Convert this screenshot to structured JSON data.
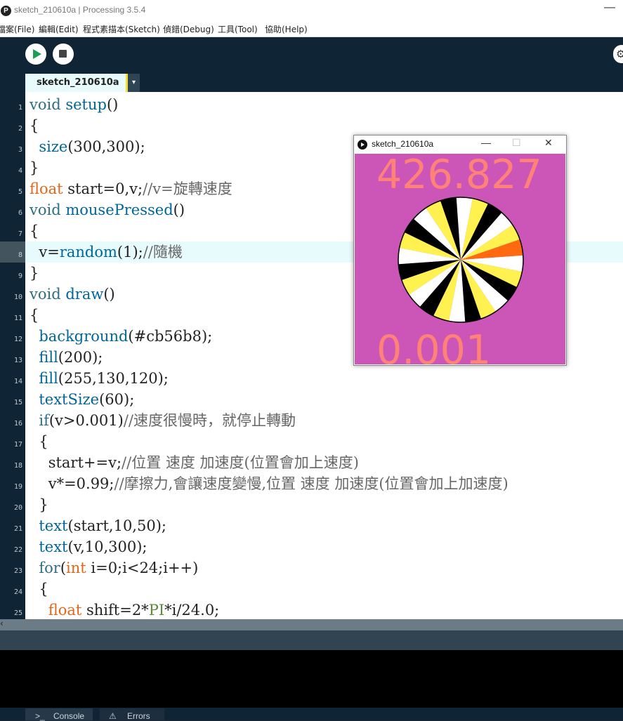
{
  "window": {
    "title": "sketch_210610a | Processing 3.5.4",
    "minimize": "—"
  },
  "menu": [
    "檔案(File)",
    "編輯(Edit)",
    "程式素描本(Sketch)",
    "偵錯(Debug)",
    "工具(Tool)",
    "協助(Help)"
  ],
  "tab": {
    "label": "sketch_210610a",
    "menu_glyph": "▾"
  },
  "code_lines": [
    "1",
    "2",
    "3",
    "4",
    "5",
    "6",
    "7",
    "8",
    "9",
    "10",
    "11",
    "12",
    "13",
    "14",
    "15",
    "16",
    "17",
    "18",
    "19",
    "20",
    "21",
    "22",
    "23",
    "24",
    "25"
  ],
  "code": {
    "l1a": "void",
    "l1b": " setup",
    "l1c": "()",
    "l2": "{",
    "l3a": "  size",
    "l3b": "(300,300);",
    "l4": "}",
    "l5a": "float",
    "l5b": " start=0,v;",
    "l5c": "//v=旋轉速度",
    "l6a": "void",
    "l6b": " mousePressed",
    "l6c": "()",
    "l7": "{",
    "l8a": "  v=",
    "l8b": "random",
    "l8c": "(1);",
    "l8d": "//隨機",
    "l9": "}",
    "l10a": "void",
    "l10b": " draw",
    "l10c": "()",
    "l11": "{",
    "l12a": "  background",
    "l12b": "(#cb56b8);",
    "l13a": "  fill",
    "l13b": "(200);",
    "l14a": "  fill",
    "l14b": "(255,130,120);",
    "l15a": "  textSize",
    "l15b": "(60);",
    "l16a": "  if",
    "l16b": "(v>0.001)",
    "l16c": "//速度很慢時，就停止轉動",
    "l17": "  {",
    "l18a": "    start+=v;",
    "l18b": "//位置 速度 加速度(位置會加上速度)",
    "l19a": "    v*=0.99;",
    "l19b": "//摩擦力,會讓速度變慢,位置 速度 加速度(位置會加上加速度)",
    "l20": "  }",
    "l21a": "  text",
    "l21b": "(start,10,50);",
    "l22a": "  text",
    "l22b": "(v,10,300);",
    "l23a": "  for",
    "l23b": "(",
    "l23c": "int",
    "l23d": " i=0;i<24;i++)",
    "l24": "  {",
    "l25a": "    float",
    "l25b": " shift=2*",
    "l25c": "PI",
    "l25d": "*i/24.0;"
  },
  "sketch": {
    "title": "sketch_210610a",
    "start_text": "426.827",
    "v_text": "0.001",
    "background": "#cb56b8",
    "text_color": "#ff8278",
    "wedge_colors": [
      "#ffffff",
      "#fff250",
      "#000000",
      "#ffffff",
      "#fff250",
      "#000000",
      "#ffffff",
      "#fff250",
      "#000000",
      "#ffffff",
      "#fff250",
      "#000000",
      "#ffffff",
      "#fff250",
      "#000000",
      "#ffffff",
      "#fff250",
      "#000000",
      "#ffffff",
      "#fff250",
      "#000000",
      "#ffffff",
      "#fff250",
      "#ff6a10"
    ]
  },
  "bottom_tabs": {
    "console": "Console",
    "errors": "Errors"
  }
}
